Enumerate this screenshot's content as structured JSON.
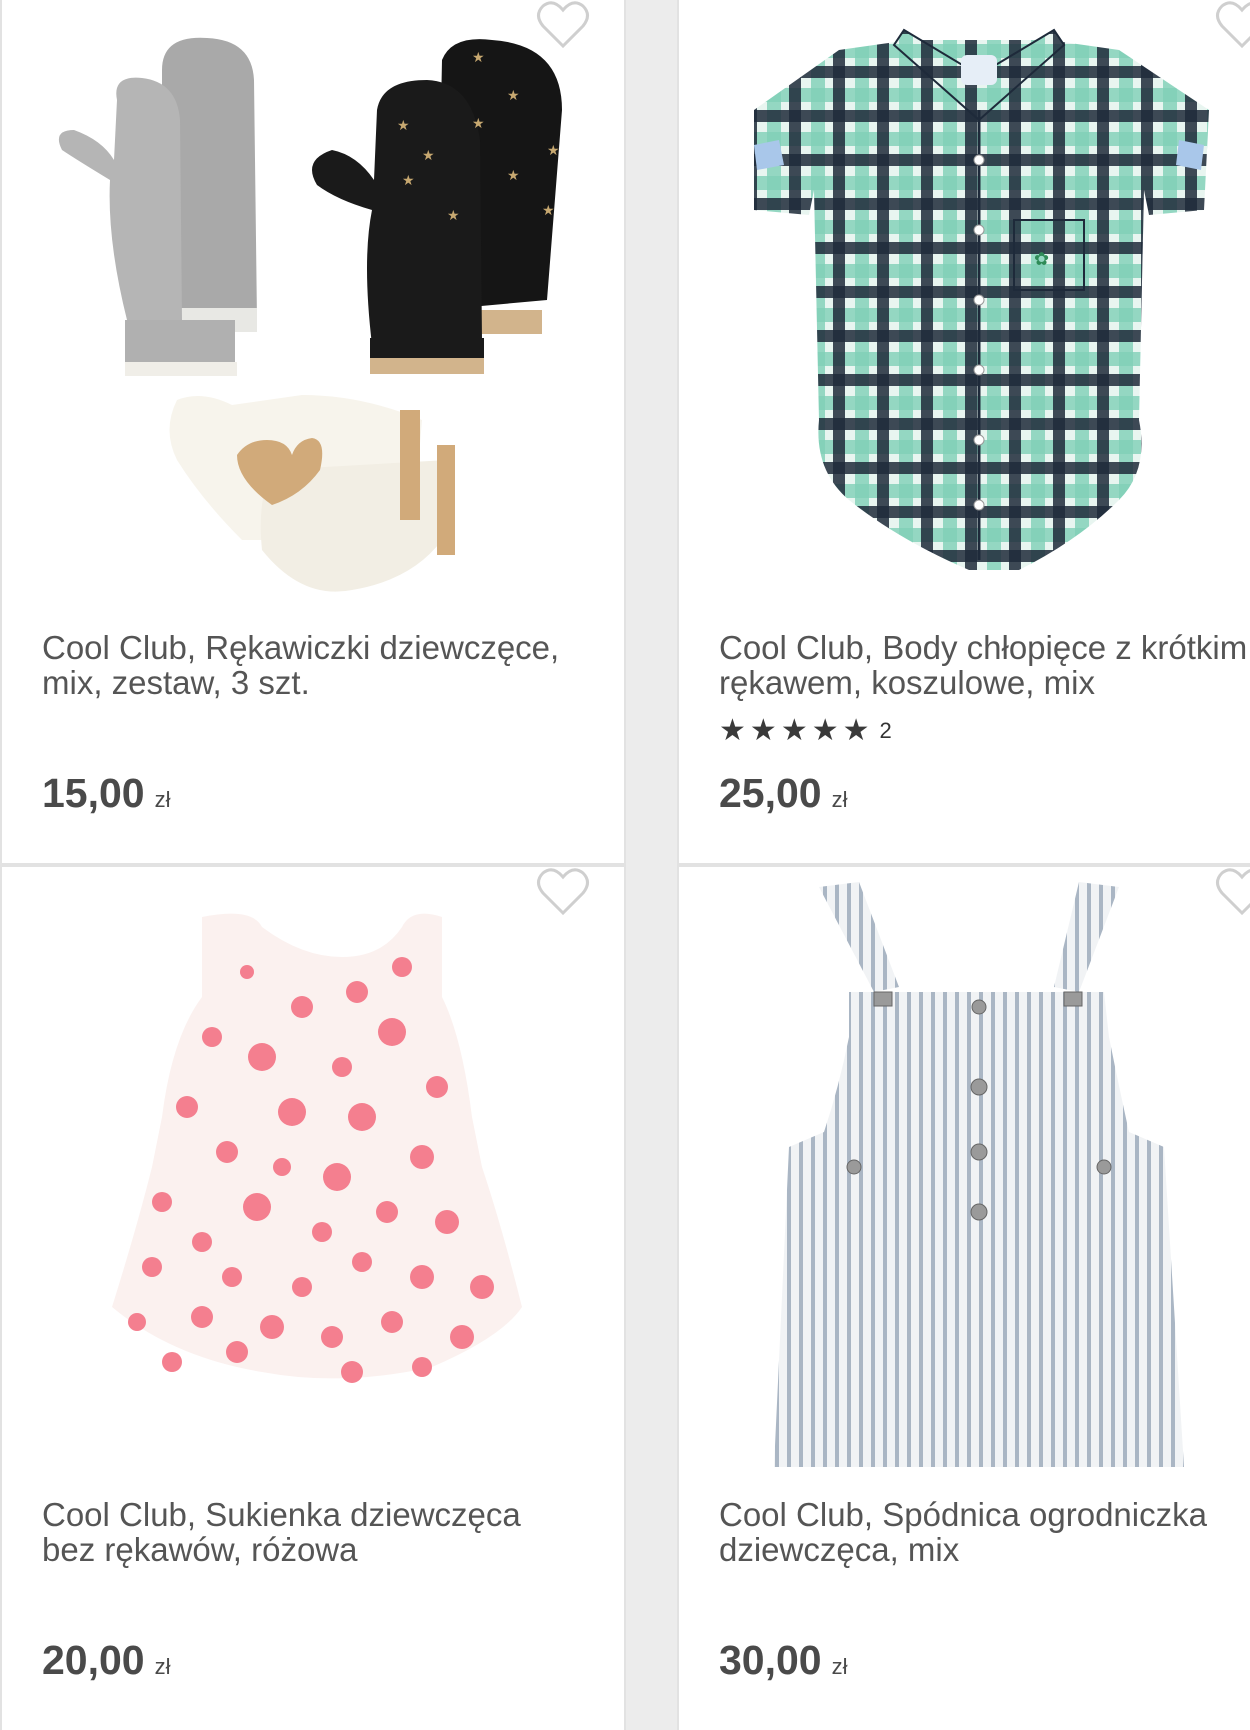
{
  "products": [
    {
      "title": "Cool Club, Rękawiczki dziewczęce,\nmix, zestaw, 3 szt.",
      "price": "15,00",
      "currency": "zł",
      "image": "mittens-set-image"
    },
    {
      "title": "Cool Club, Body chłopięce z krótkim\nrękawem, koszulowe, mix",
      "price": "25,00",
      "currency": "zł",
      "rating": {
        "stars": 5,
        "count": "2"
      },
      "image": "plaid-shirt-bodysuit-image"
    },
    {
      "title": "Cool Club, Sukienka dziewczęca\nbez rękawów, różowa",
      "price": "20,00",
      "currency": "zł",
      "image": "polka-dot-dress-image"
    },
    {
      "title": "Cool Club, Spódnica ogrodniczka\ndziewczęca, mix",
      "price": "30,00",
      "currency": "zł",
      "image": "striped-pinafore-image"
    }
  ],
  "icons": {
    "favorite": "heart-outline-icon",
    "star": "star-icon"
  },
  "colors": {
    "text": "#555555",
    "price": "#4a4a4a",
    "star": "#3a3a3a",
    "heart": "#cfcfcf",
    "background": "#ececec"
  }
}
